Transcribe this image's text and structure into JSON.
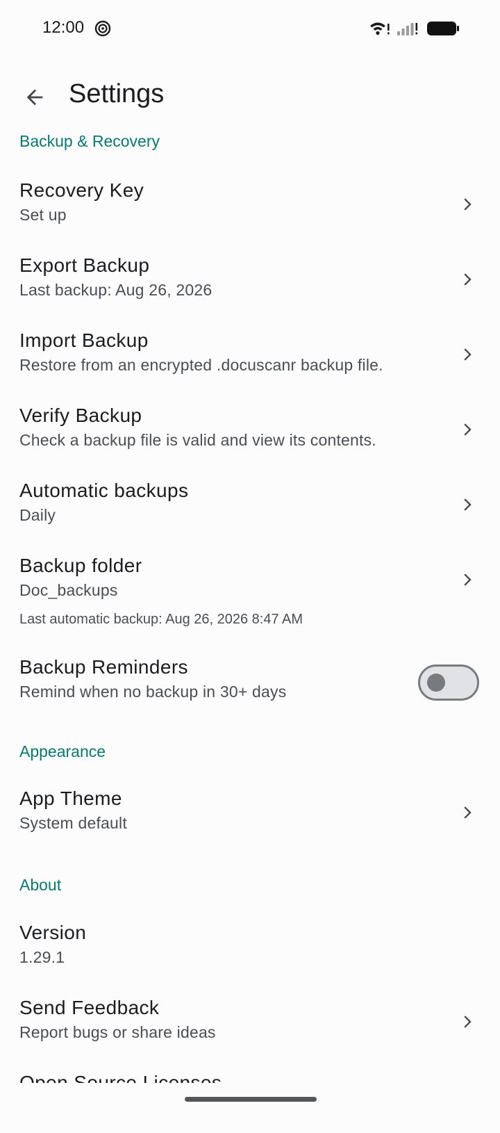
{
  "status_bar": {
    "time": "12:00",
    "icons": [
      "app-notification-icon",
      "wifi-icon",
      "signal-icon",
      "battery-icon"
    ]
  },
  "app_bar": {
    "title": "Settings",
    "back_icon": "arrow-left-icon"
  },
  "colors": {
    "accent": "#07786e",
    "background": "#fcfcfd",
    "text_primary": "#1b1c1e",
    "text_secondary": "#4a4d52"
  },
  "sections": {
    "backup": {
      "header": "Backup & Recovery",
      "items": [
        {
          "title": "Recovery Key",
          "subtitle": "Set up"
        },
        {
          "title": "Export Backup",
          "subtitle": "Last backup: Aug 26, 2026"
        },
        {
          "title": "Import Backup",
          "subtitle": "Restore from an encrypted .docuscanr backup file."
        },
        {
          "title": "Verify Backup",
          "subtitle": "Check a backup file is valid and view its contents."
        },
        {
          "title": "Automatic backups",
          "subtitle": "Daily"
        },
        {
          "title": "Backup folder",
          "subtitle": "Doc_backups"
        }
      ],
      "last_auto_backup": "Last automatic backup: Aug 26, 2026 8:47 AM",
      "reminders": {
        "title": "Backup Reminders",
        "subtitle": "Remind when no backup in 30+ days",
        "enabled": false
      }
    },
    "appearance": {
      "header": "Appearance",
      "items": [
        {
          "title": "App Theme",
          "subtitle": "System default"
        }
      ]
    },
    "about": {
      "header": "About",
      "items": [
        {
          "title": "Version",
          "subtitle": "1.29.1"
        },
        {
          "title": "Send Feedback",
          "subtitle": "Report bugs or share ideas"
        },
        {
          "title": "Open Source Licenses",
          "subtitle": ""
        }
      ]
    }
  }
}
